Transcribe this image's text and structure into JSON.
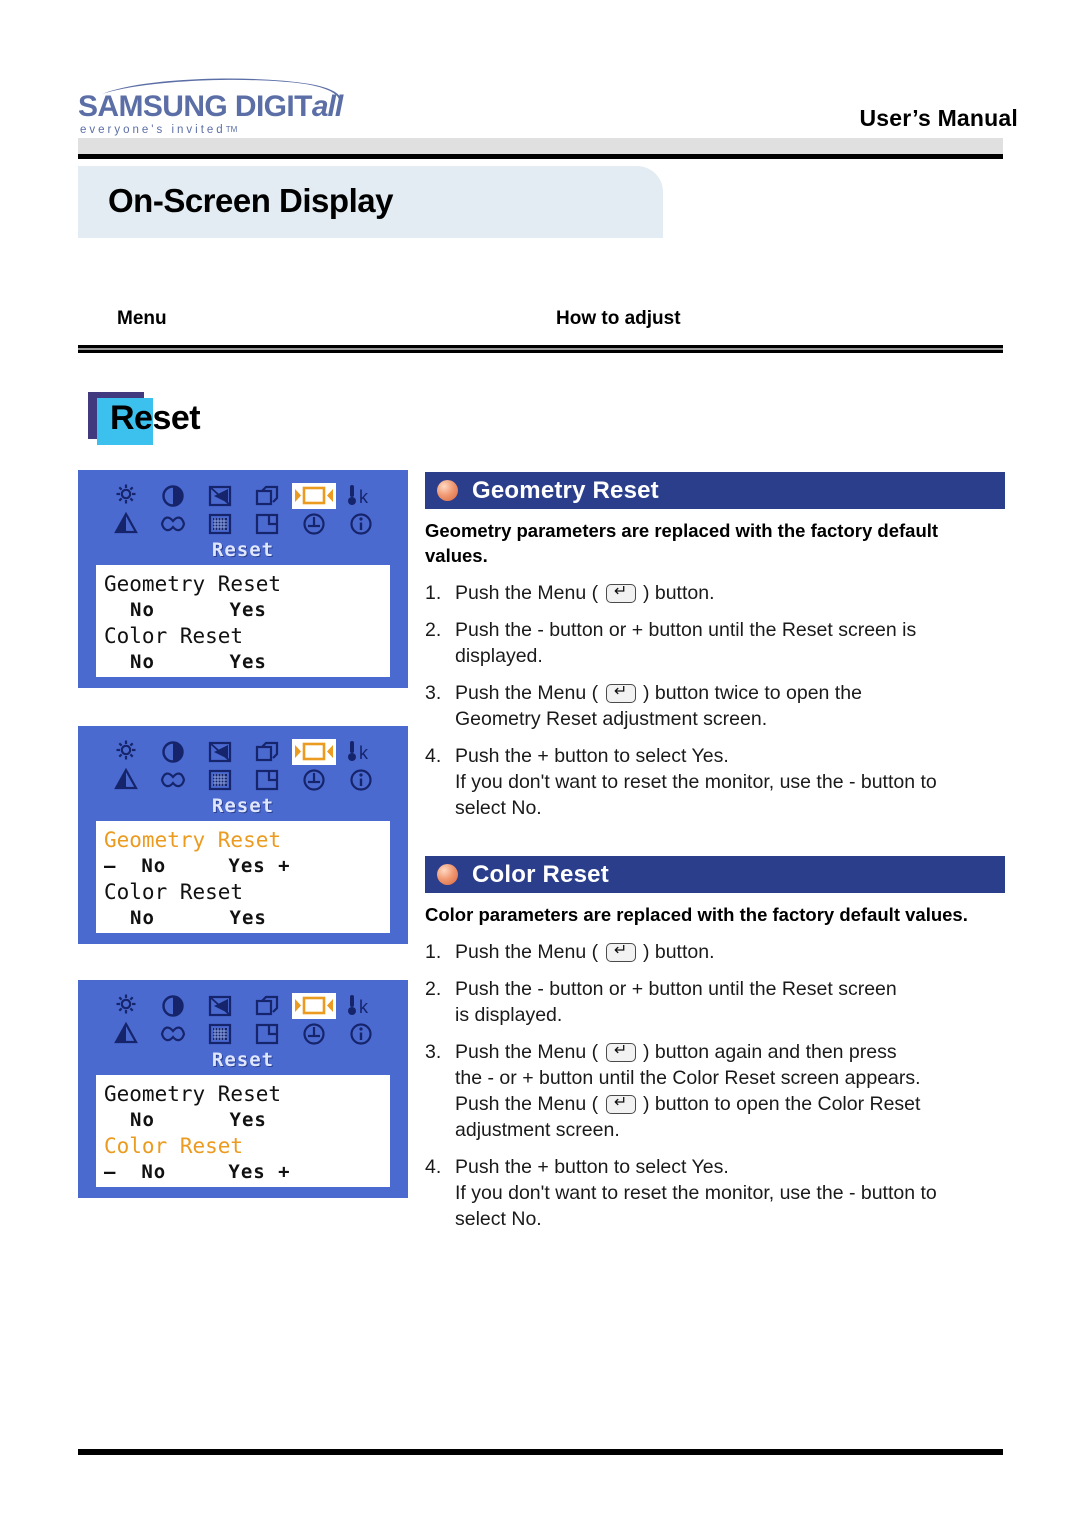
{
  "brand": {
    "name_samsung": "SAMSUNG DIGIT",
    "name_italic": "all",
    "tagline": "everyone's invited",
    "tagline_tm": "TM"
  },
  "header": {
    "manual_title": "User’s Manual",
    "section_title": "On-Screen Display"
  },
  "columns": {
    "menu": "Menu",
    "how_to_adjust": "How to adjust"
  },
  "page_heading": {
    "label": "Reset",
    "chip_color": "#3cc0ee",
    "chip_shadow_color": "#413a7e"
  },
  "osd_panels": [
    {
      "name": "reset-menu-default",
      "title": "Reset",
      "lines": [
        {
          "text": "Geometry Reset",
          "highlight": false,
          "type": "label"
        },
        {
          "text": "No      Yes",
          "highlight": false,
          "type": "options"
        },
        {
          "text": "Color Reset",
          "highlight": false,
          "type": "label"
        },
        {
          "text": "No      Yes",
          "highlight": false,
          "type": "options"
        }
      ]
    },
    {
      "name": "geometry-reset-selected",
      "title": "Reset",
      "lines": [
        {
          "text": "Geometry Reset",
          "highlight": true,
          "type": "label"
        },
        {
          "text": "–  No     Yes +",
          "highlight": false,
          "type": "options"
        },
        {
          "text": "Color Reset",
          "highlight": false,
          "type": "label"
        },
        {
          "text": "No      Yes",
          "highlight": false,
          "type": "options"
        }
      ]
    },
    {
      "name": "color-reset-selected",
      "title": "Reset",
      "lines": [
        {
          "text": "Geometry Reset",
          "highlight": false,
          "type": "label"
        },
        {
          "text": "No      Yes",
          "highlight": false,
          "type": "options"
        },
        {
          "text": "Color Reset",
          "highlight": true,
          "type": "label"
        },
        {
          "text": "–  No     Yes +",
          "highlight": false,
          "type": "options"
        }
      ]
    }
  ],
  "osd_icons": {
    "row1": [
      "brightness-icon",
      "contrast-icon",
      "pincushion-icon",
      "trapezoid-icon",
      "position-size-icon",
      "color-temperature-icon"
    ],
    "row2": [
      "sharpness-icon",
      "pillow-balance-icon",
      "moire-icon",
      "parallelogram-icon",
      "rotation-icon",
      "information-icon"
    ],
    "highlighted_index": 4,
    "highlight_color": "#eb9b20"
  },
  "sections": [
    {
      "id": "geometry-reset",
      "bar_title": "Geometry Reset",
      "description": "Geometry parameters are replaced with the factory default values.",
      "steps": [
        {
          "num": "1.",
          "parts": [
            "Push the Menu ( ",
            "KEY",
            " ) button."
          ]
        },
        {
          "num": "2.",
          "parts": [
            "Push the - button or + button until the Reset screen is displayed."
          ]
        },
        {
          "num": "3.",
          "parts": [
            "Push the Menu ( ",
            "KEY",
            " ) button twice to open the Geometry Reset adjustment screen."
          ]
        },
        {
          "num": "4.",
          "parts": [
            "Push the + button to select Yes."
          ],
          "sub": "If you don't want to reset the monitor, use the - button to select No."
        }
      ]
    },
    {
      "id": "color-reset",
      "bar_title": "Color Reset",
      "description": "Color parameters are replaced with the factory default values.",
      "steps": [
        {
          "num": "1.",
          "parts": [
            "Push the Menu ( ",
            "KEY",
            " ) button."
          ]
        },
        {
          "num": "2.",
          "parts": [
            "Push the - button or + button until the Reset screen is displayed."
          ]
        },
        {
          "num": "3.",
          "parts": [
            "Push the Menu ( ",
            "KEY",
            " ) button again and then press the - or + button until the Color Reset screen appears. Push the Menu ( ",
            "KEY",
            " ) button to open the Color Reset adjustment screen."
          ]
        },
        {
          "num": "4.",
          "parts": [
            "Push the + button to select Yes."
          ],
          "sub": "If you don't want to reset the monitor, use the - button to select No."
        }
      ]
    }
  ],
  "step_text": {
    "g1_a": "Push the Menu (",
    "g1_b": ") button.",
    "g2": "Push the - button or + button until the Reset screen is",
    "g2_b": "displayed.",
    "g3_a": "Push the Menu (",
    "g3_b": ") button twice to open the",
    "g3_c": "Geometry Reset adjustment screen.",
    "g4_a": "Push the + button to select Yes.",
    "g4_b": "If you don't want to reset the monitor, use the - button to",
    "g4_c": "select No.",
    "c1_a": "Push the Menu (",
    "c1_b": ") button.",
    "c2": "Push the - button or + button until the Reset screen",
    "c2_b": "is displayed.",
    "c3_a": "Push the Menu (",
    "c3_b": ") button again and then press",
    "c3_c": "the - or + button until the Color Reset screen appears.",
    "c3_d": "Push the Menu (",
    "c3_e": ") button to open the Color Reset",
    "c3_f": "adjustment screen.",
    "c4_a": "Push the + button to select Yes.",
    "c4_b": "If you don't want to reset the monitor, use the - button to",
    "c4_c": "select No."
  },
  "step_numbers": {
    "one": "1.",
    "two": "2.",
    "three": "3.",
    "four": "4."
  },
  "colors": {
    "osd_background": "#4a6ad0",
    "section_bar": "#2b3e8c",
    "banner": "#e2ecf2",
    "brand": "#5b6ea6"
  }
}
